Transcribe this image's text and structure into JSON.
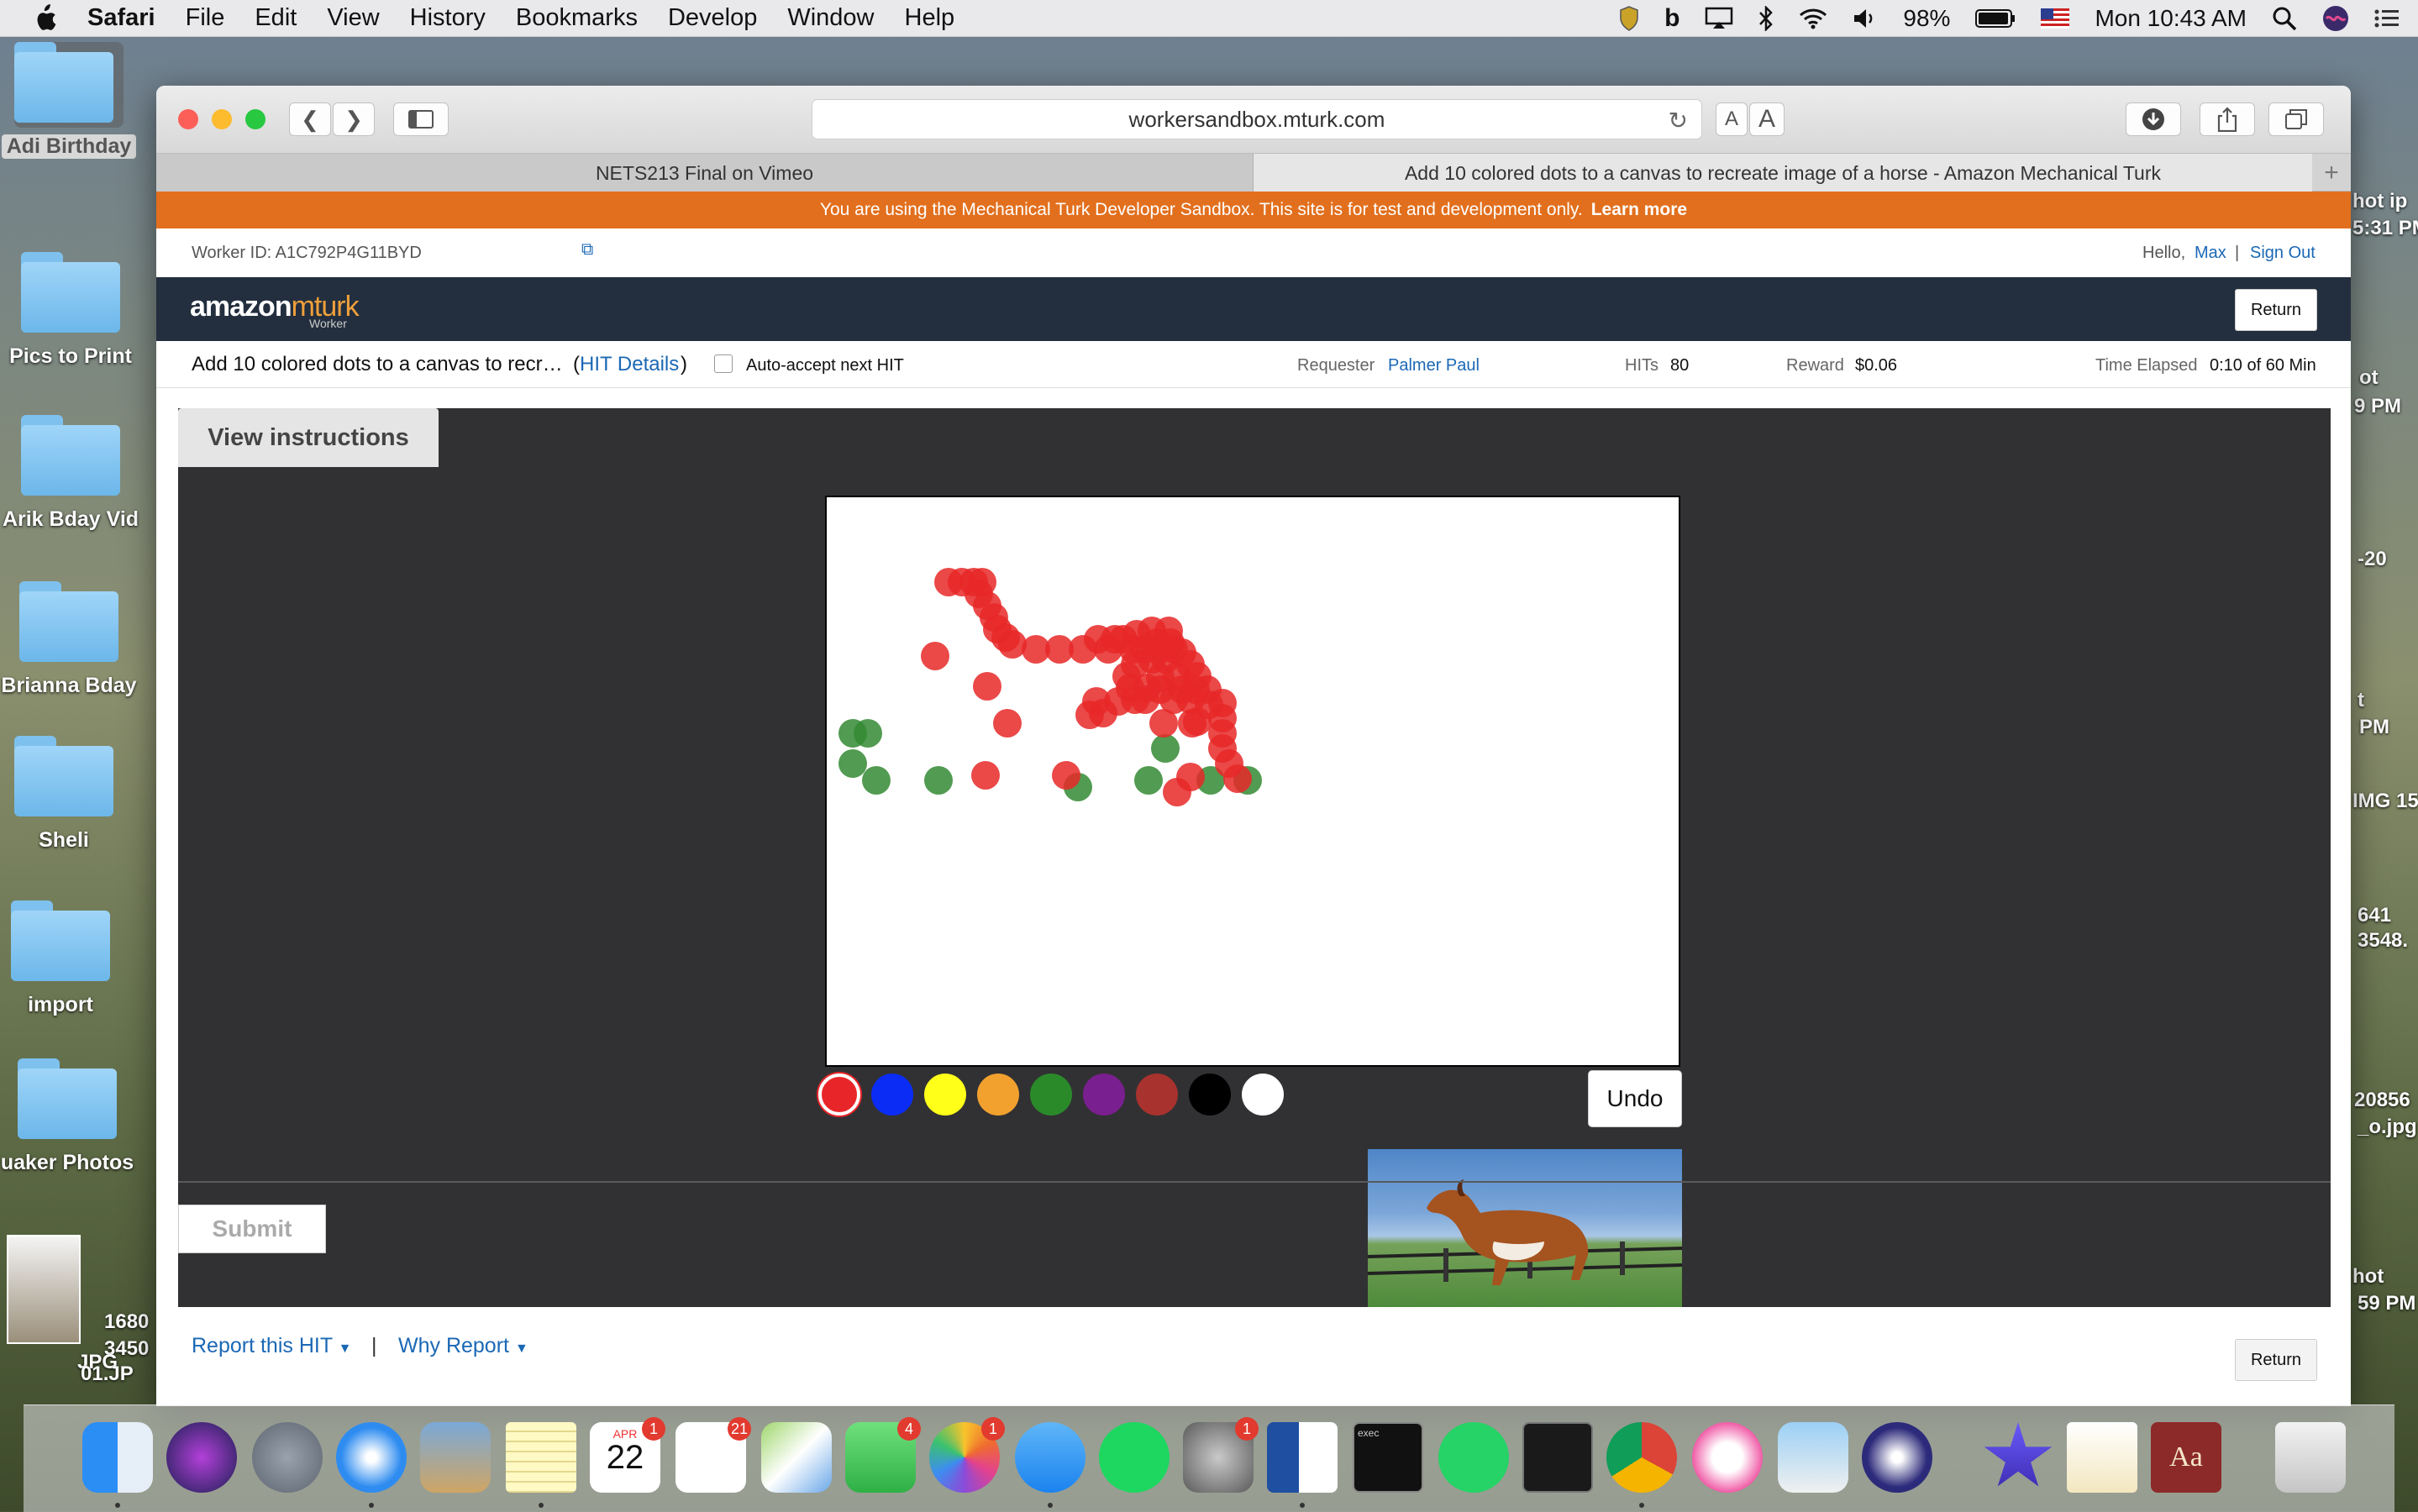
{
  "menubar": {
    "app": "Safari",
    "items": [
      "File",
      "Edit",
      "View",
      "History",
      "Bookmarks",
      "Develop",
      "Window",
      "Help"
    ],
    "battery": "98%",
    "clock": "Mon 10:43 AM"
  },
  "desktop": {
    "icons": [
      "Adi Birthday",
      "Pics to Print",
      "Arik Bday Vid",
      "Brianna Bday",
      "Sheli",
      "import",
      "uaker Photos"
    ],
    "bottom_left": [
      "1680",
      "3450",
      "JPG",
      "01.JP"
    ],
    "right_edge": [
      "hot ip",
      "5:31 PM",
      "ot",
      "9 PM",
      "-20",
      "t",
      "PM",
      "IMG 15",
      "641",
      "3548.",
      "20856",
      "_o.jpg",
      "hot",
      "59 PM"
    ]
  },
  "browser": {
    "url": "workersandbox.mturk.com",
    "text_small": "A",
    "text_large": "A",
    "tabs": [
      {
        "title": "NETS213 Final on Vimeo"
      },
      {
        "title": "Add 10 colored dots to a canvas to recreate image of a horse - Amazon Mechanical Turk"
      }
    ]
  },
  "banner": {
    "text": "You are using the Mechanical Turk Developer Sandbox. This site is for test and development only.",
    "link": "Learn more"
  },
  "worker": {
    "id": "Worker ID: A1C792P4G11BYD",
    "hello": "Hello,",
    "name": "Max",
    "divider": "|",
    "sign_out": "Sign Out"
  },
  "brand": {
    "logo_a": "amazon",
    "logo_b": "mturk",
    "logo_sub": "Worker",
    "return": "Return"
  },
  "hit": {
    "title": "Add 10 colored dots to a canvas to recr…",
    "paren_open": "(",
    "details": "HIT Details",
    "paren_close": ")",
    "auto_accept": "Auto-accept next HIT",
    "requester_label": "Requester",
    "requester": "Palmer Paul",
    "hits_label": "HITs",
    "hits": "80",
    "reward_label": "Reward",
    "reward": "$0.06",
    "time_label": "Time Elapsed",
    "time": "0:10 of 60 Min"
  },
  "task": {
    "instructions_button": "View instructions",
    "undo": "Undo",
    "submit": "Submit",
    "palette": [
      "#e8262a",
      "#0a2cf5",
      "#ffff1a",
      "#f2a12e",
      "#2a8a2a",
      "#7a1f8f",
      "#a8322e",
      "#000000",
      "#ffffff"
    ],
    "selected_color": "#e8262a"
  },
  "footer": {
    "report": "Report this HIT",
    "sep": "|",
    "why": "Why Report",
    "return": "Return"
  },
  "dock": {
    "calendar_month": "APR",
    "calendar_day": "22",
    "badges": {
      "calendar": "1",
      "reminders": "21",
      "facetime": "4",
      "photos": "1",
      "prefs": "1"
    },
    "terminal_label": "exec",
    "dictionary_label": "Aa"
  }
}
